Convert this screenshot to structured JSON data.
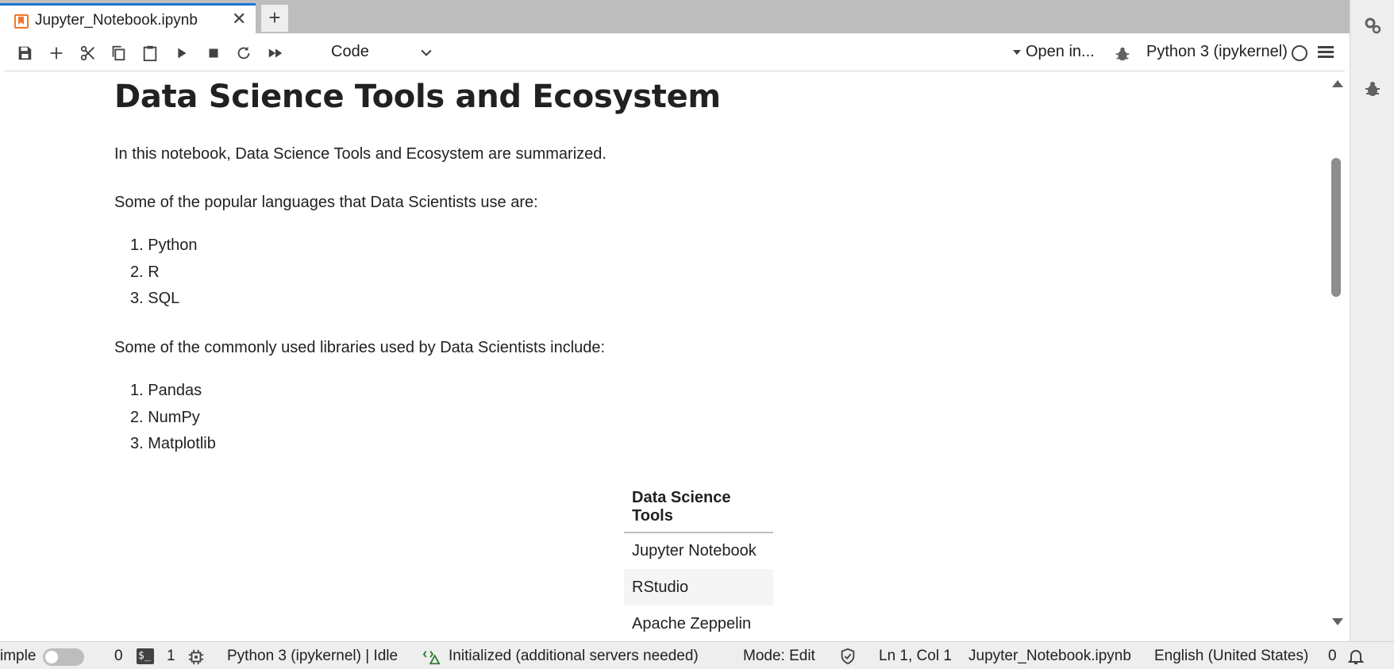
{
  "tab": {
    "title": "Jupyter_Notebook.ipynb",
    "close": "✕",
    "new_tab": "+"
  },
  "toolbar": {
    "cell_type": "Code",
    "open_in": "Open in...",
    "kernel": "Python 3 (ipykernel)"
  },
  "notebook": {
    "heading": "Data Science Tools and Ecosystem",
    "intro": "In this notebook, Data Science Tools and Ecosystem are summarized.",
    "languages_intro": "Some of the popular languages that Data Scientists use are:",
    "languages": [
      "1. Python",
      "2. R",
      "3. SQL"
    ],
    "libraries_intro": "Some of the commonly used libraries used by Data Scientists include:",
    "libraries": [
      "1. Pandas",
      "2. NumPy",
      "3. Matplotlib"
    ],
    "table": {
      "header": "Data Science Tools",
      "rows": [
        "Jupyter Notebook",
        "RStudio",
        "Apache Zeppelin"
      ]
    }
  },
  "statusbar": {
    "simple_label": "imple",
    "terminals_count": "0",
    "kernels_count": "1",
    "kernel_status": "Python 3 (ipykernel) | Idle",
    "lsp_status": "Initialized (additional servers needed)",
    "mode": "Mode: Edit",
    "cursor": "Ln 1, Col 1",
    "filename": "Jupyter_Notebook.ipynb",
    "language": "English (United States)",
    "notifications": "0"
  },
  "colors": {
    "accent": "#1976d2",
    "notebook_icon": "#f37726",
    "chrome": "#eeeeee",
    "tabbar": "#bdbdbd"
  }
}
